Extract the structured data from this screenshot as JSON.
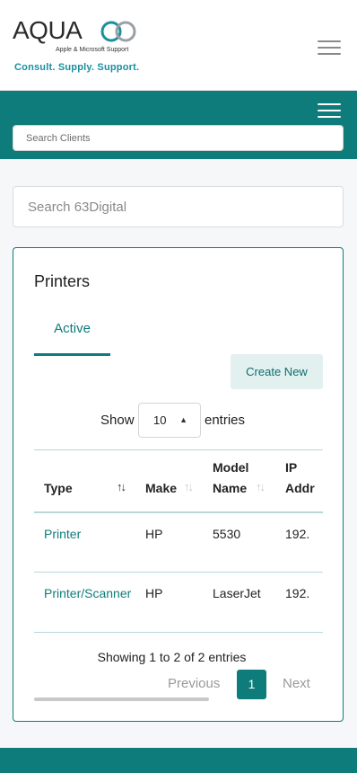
{
  "header": {
    "logo_word": "AQUA",
    "logo_sub": "Apple & Microsoft Support",
    "logo_tagline": "Consult. Supply. Support.",
    "menu_icon": "hamburger-menu-icon"
  },
  "client_bar": {
    "search_placeholder": "Search Clients",
    "menu_icon": "hamburger-menu-icon"
  },
  "global_search": {
    "placeholder": "Search 63Digital"
  },
  "panel": {
    "title": "Printers",
    "tabs": [
      {
        "label": "Active",
        "selected": true
      }
    ],
    "create_label": "Create New",
    "length_menu": {
      "show_label": "Show",
      "selected": "10",
      "entries_label": "entries"
    },
    "columns": [
      {
        "line1": "Type",
        "line2": ""
      },
      {
        "line1": "Make",
        "line2": ""
      },
      {
        "line1": "Model",
        "line2": "Name"
      },
      {
        "line1": "IP",
        "line2": "Addr"
      }
    ],
    "rows": [
      {
        "type": "Printer",
        "make": "HP",
        "model": "5530",
        "ip": "192."
      },
      {
        "type": "Printer/Scanner",
        "make": "HP",
        "model": "LaserJet",
        "ip": "192."
      }
    ],
    "info": "Showing 1 to 2 of 2 entries",
    "pagination": {
      "previous": "Previous",
      "current": "1",
      "next": "Next"
    }
  },
  "colors": {
    "brand_teal": "#0e7c7b",
    "logo_tagline": "#1a8fa0",
    "button_tint": "#e2f0ef"
  }
}
